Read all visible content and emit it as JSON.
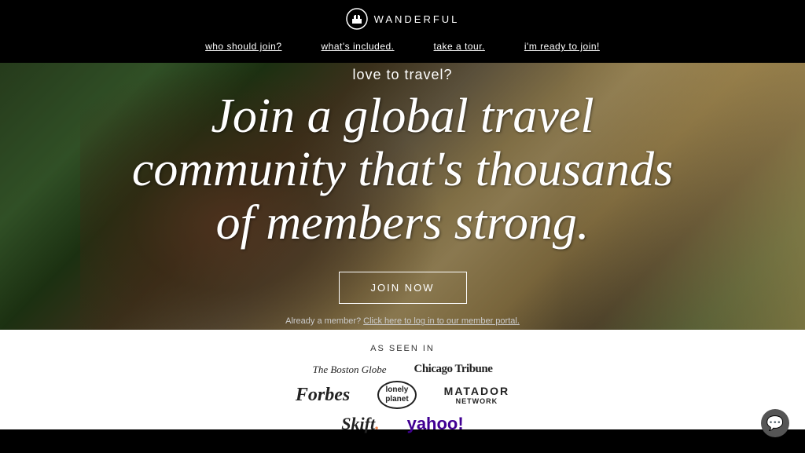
{
  "logo": {
    "text": "WANDERFUL",
    "icon_name": "castle-globe-icon"
  },
  "nav": {
    "items": [
      {
        "label": "who should join?",
        "id": "who-should-join"
      },
      {
        "label": "what's included.",
        "id": "whats-included"
      },
      {
        "label": "take a tour.",
        "id": "take-a-tour"
      },
      {
        "label": "i'm ready to join!",
        "id": "ready-to-join"
      }
    ]
  },
  "hero": {
    "subtitle": "love to travel?",
    "title": "Join a global travel community that's thousands of members strong.",
    "join_button": "JOIN NOW",
    "member_text": "Already a member?",
    "member_link_text": "Click here to log in to our member portal."
  },
  "as_seen_in": {
    "label": "AS SEEN IN",
    "logos": [
      {
        "name": "The Boston Globe",
        "style": "boston-globe"
      },
      {
        "name": "Chicago Tribune",
        "style": "chicago-tribune"
      },
      {
        "name": "Forbes",
        "style": "forbes"
      },
      {
        "name": "lonely planet",
        "style": "lonely-planet"
      },
      {
        "name": "MATADOR NETWORK",
        "style": "matador"
      },
      {
        "name": "Skift.",
        "style": "skift"
      },
      {
        "name": "yahoo!",
        "style": "yahoo"
      }
    ]
  },
  "chat": {
    "icon_name": "chat-icon"
  }
}
